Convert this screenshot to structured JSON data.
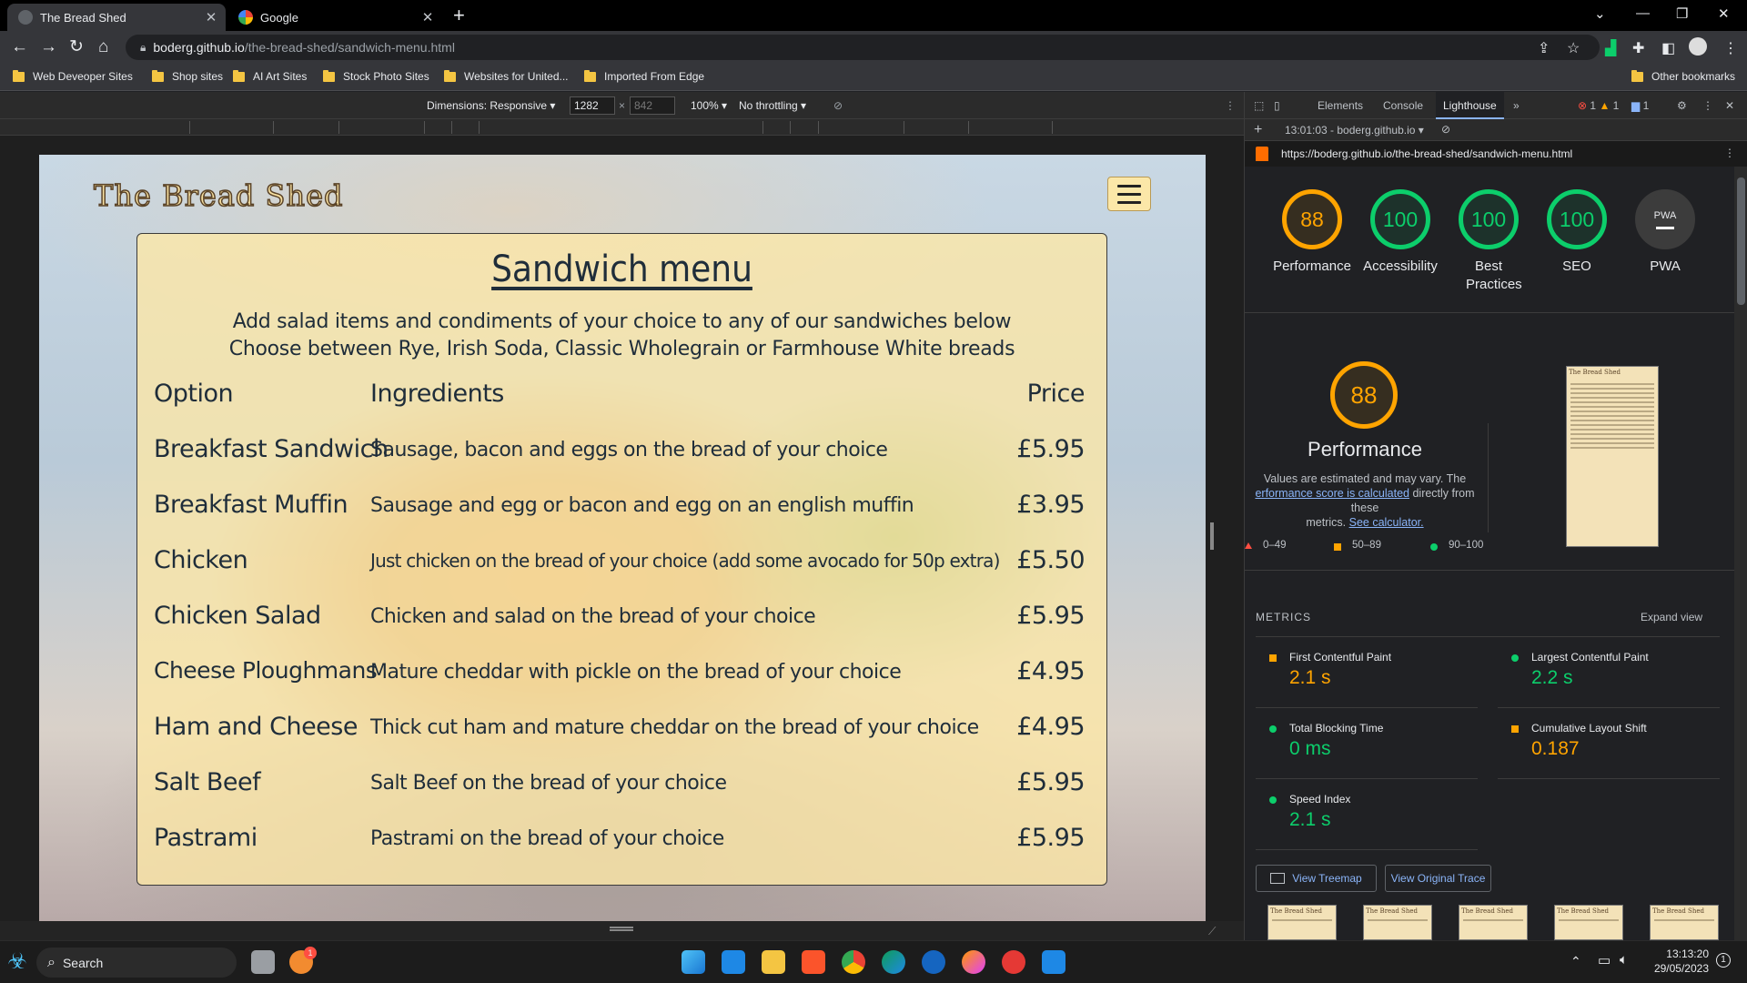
{
  "tabs": [
    {
      "title": "The Bread Shed",
      "active": true
    },
    {
      "title": "Google",
      "active": false
    }
  ],
  "omnibox": {
    "host": "boderg.github.io",
    "path": "/the-bread-shed/sandwich-menu.html"
  },
  "bookmarks": [
    "Web Deveoper Sites",
    "Shop sites",
    "AI Art Sites",
    "Stock Photo Sites",
    "Websites for United...",
    "Imported From Edge"
  ],
  "other_bookmarks": "Other bookmarks",
  "device_toolbar": {
    "dimensions_label": "Dimensions: Responsive",
    "width": "1282",
    "height": "842",
    "zoom": "100%",
    "throttling": "No throttling"
  },
  "site": {
    "title": "The Bread Shed",
    "menu_heading": "Sandwich menu",
    "intro_1": "Add salad items and condiments of your choice to any of our sandwiches below",
    "intro_2": "Choose between Rye, Irish Soda, Classic Wholegrain or Farmhouse White breads",
    "headers": {
      "option": "Option",
      "ingredients": "Ingredients",
      "price": "Price"
    },
    "items": [
      {
        "option": "Breakfast Sandwich",
        "ingredients": "Sausage, bacon and eggs on the bread of your choice",
        "price": "£5.95"
      },
      {
        "option": "Breakfast Muffin",
        "ingredients": "Sausage and egg or bacon and egg on an english muffin",
        "price": "£3.95"
      },
      {
        "option": "Chicken",
        "ingredients": "Just chicken on the bread of your choice (add some avocado for 50p extra)",
        "price": "£5.50"
      },
      {
        "option": "Chicken Salad",
        "ingredients": "Chicken and salad on the bread of your choice",
        "price": "£5.95"
      },
      {
        "option": "Cheese Ploughmans",
        "ingredients": "Mature cheddar with pickle on the bread of your choice",
        "price": "£4.95"
      },
      {
        "option": "Ham and Cheese",
        "ingredients": "Thick cut ham and mature cheddar on the bread of your choice",
        "price": "£4.95"
      },
      {
        "option": "Salt Beef",
        "ingredients": "Salt Beef on the bread of your choice",
        "price": "£5.95"
      },
      {
        "option": "Pastrami",
        "ingredients": "Pastrami on the bread of your choice",
        "price": "£5.95"
      }
    ]
  },
  "devtools": {
    "tabs": [
      "Elements",
      "Console",
      "Lighthouse"
    ],
    "active_tab": "Lighthouse",
    "badges": {
      "errors": "1",
      "warnings": "1",
      "messages": "1"
    },
    "report_select": "13:01:03 - boderg.github.io",
    "url": "https://boderg.github.io/the-bread-shed/sandwich-menu.html",
    "scores": [
      {
        "label": "Performance",
        "value": "88",
        "color": "#ffa400"
      },
      {
        "label": "Accessibility",
        "value": "100",
        "color": "#0cce6b"
      },
      {
        "label": "Best Practices",
        "value": "100",
        "color": "#0cce6b"
      },
      {
        "label": "SEO",
        "value": "100",
        "color": "#0cce6b"
      },
      {
        "label": "PWA",
        "value": "PWA",
        "color": "#3c3c3c"
      }
    ],
    "perf_score": "88",
    "perf_title": "Performance",
    "perf_note_1": "Values are estimated and may vary. The",
    "perf_note_link": "erformance score is calculated",
    "perf_note_2": "directly from these",
    "perf_note_3": "metrics.",
    "perf_note_calc": "See calculator.",
    "legend": [
      "0–49",
      "50–89",
      "90–100"
    ],
    "metrics_title": "METRICS",
    "expand_view": "Expand view",
    "metrics": [
      {
        "name": "First Contentful Paint",
        "value": "2.1 s",
        "status": "average"
      },
      {
        "name": "Largest Contentful Paint",
        "value": "2.2 s",
        "status": "pass"
      },
      {
        "name": "Total Blocking Time",
        "value": "0 ms",
        "status": "pass"
      },
      {
        "name": "Cumulative Layout Shift",
        "value": "0.187",
        "status": "average"
      },
      {
        "name": "Speed Index",
        "value": "2.1 s",
        "status": "pass"
      }
    ],
    "view_treemap": "View Treemap",
    "view_trace": "View Original Trace"
  },
  "taskbar": {
    "search": "Search",
    "time": "13:13:20",
    "date": "29/05/2023",
    "notif_count": "1"
  },
  "colors": {
    "average": "#ffa400",
    "pass": "#0cce6b",
    "fail": "#ff4e42",
    "accent": "#8ab4f8"
  }
}
